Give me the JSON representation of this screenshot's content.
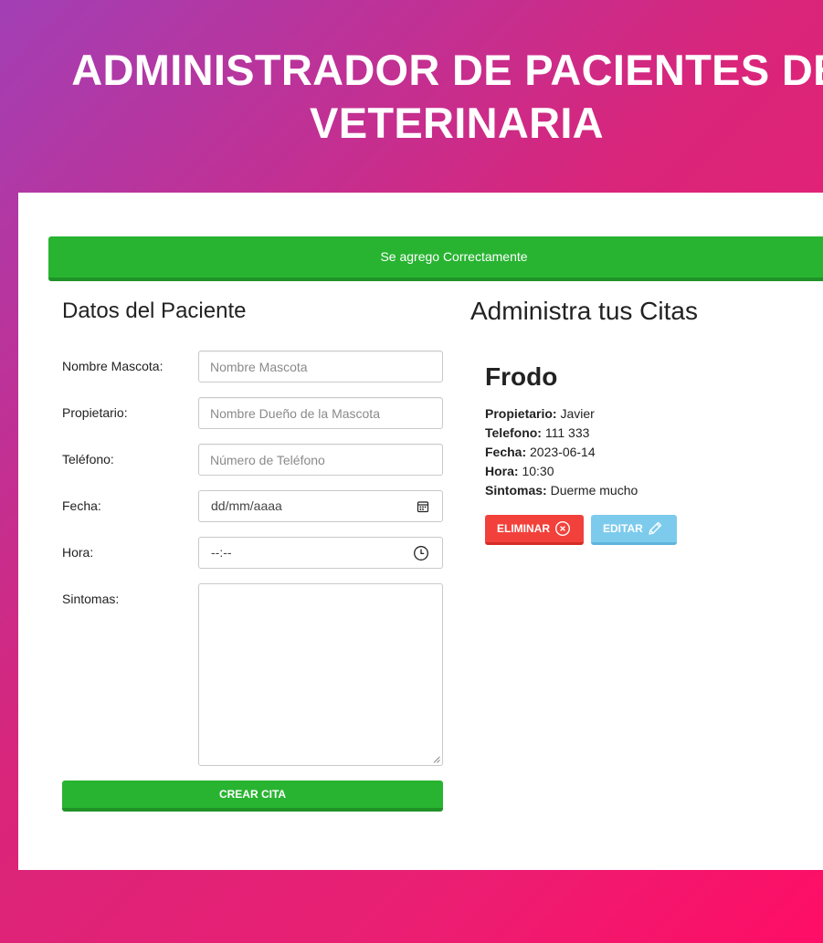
{
  "header": {
    "title": "ADMINISTRADOR DE PACIENTES DE VETERINARIA"
  },
  "alert": {
    "message": "Se agrego Correctamente",
    "color": "#28b431"
  },
  "form": {
    "title": "Datos del Paciente",
    "fields": {
      "mascota": {
        "label": "Nombre Mascota:",
        "placeholder": "Nombre Mascota"
      },
      "propietario": {
        "label": "Propietario:",
        "placeholder": "Nombre Dueño de la Mascota"
      },
      "telefono": {
        "label": "Teléfono:",
        "placeholder": "Número de Teléfono"
      },
      "fecha": {
        "label": "Fecha:",
        "placeholder": "dd/mm/aaaa",
        "icon": "calendar-icon"
      },
      "hora": {
        "label": "Hora:",
        "placeholder": "--:--",
        "icon": "clock-icon"
      },
      "sintomas": {
        "label": "Sintomas:"
      }
    },
    "submit_label": "CREAR CITA"
  },
  "citas": {
    "title": "Administra tus Citas",
    "items": [
      {
        "mascota": "Frodo",
        "propietario_label": "Propietario:",
        "propietario": "Javier",
        "telefono_label": "Telefono:",
        "telefono": "111 333",
        "fecha_label": "Fecha:",
        "fecha": "2023-06-14",
        "hora_label": "Hora:",
        "hora": "10:30",
        "sintomas_label": "Sintomas:",
        "sintomas": "Duerme mucho",
        "delete_label": "ELIMINAR",
        "delete_icon": "x-circle-icon",
        "edit_label": "EDITAR",
        "edit_icon": "pencil-icon"
      }
    ]
  },
  "colors": {
    "danger": "#f2413b",
    "edit": "#7ccbed",
    "success": "#28b431"
  }
}
